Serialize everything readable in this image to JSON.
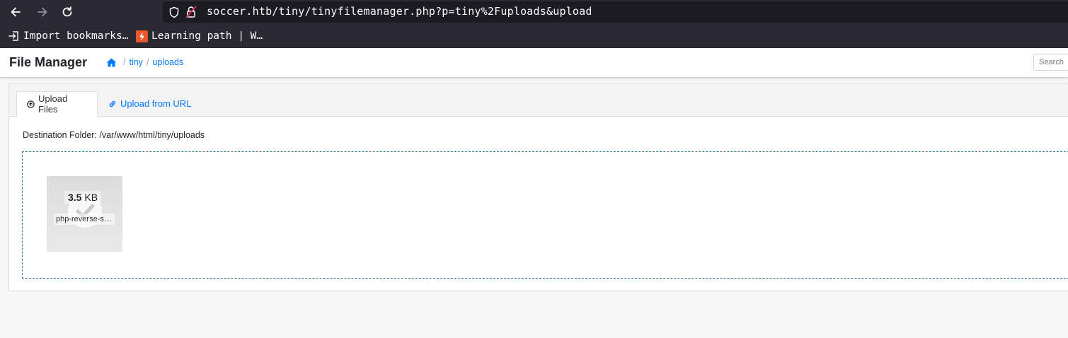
{
  "browser": {
    "url": "soccer.htb/tiny/tinyfilemanager.php?p=tiny%2Fuploads&upload",
    "bookmarks": [
      {
        "label": "Import bookmarks…",
        "icon": "import-icon"
      },
      {
        "label": "Learning path | W…",
        "icon": "learning-path-favicon"
      }
    ],
    "colors": {
      "toolbar": "#2b2a33",
      "urlbar": "#1c1b22"
    }
  },
  "header": {
    "brand": "File Manager",
    "breadcrumb": [
      "tiny",
      "uploads"
    ],
    "search_placeholder": "Search"
  },
  "tabs": [
    {
      "label": "Upload Files",
      "icon": "upload-circle-icon",
      "active": true
    },
    {
      "label": "Upload from URL",
      "icon": "link-icon",
      "active": false
    }
  ],
  "destination": "Destination Folder: /var/www/html/tiny/uploads",
  "upload": {
    "size_value": "3.5",
    "size_unit": "KB",
    "filename": "php-reverse-shell.php",
    "status": "success"
  },
  "colors": {
    "link": "#007bff",
    "dropzone_border": "#2a7a98"
  }
}
